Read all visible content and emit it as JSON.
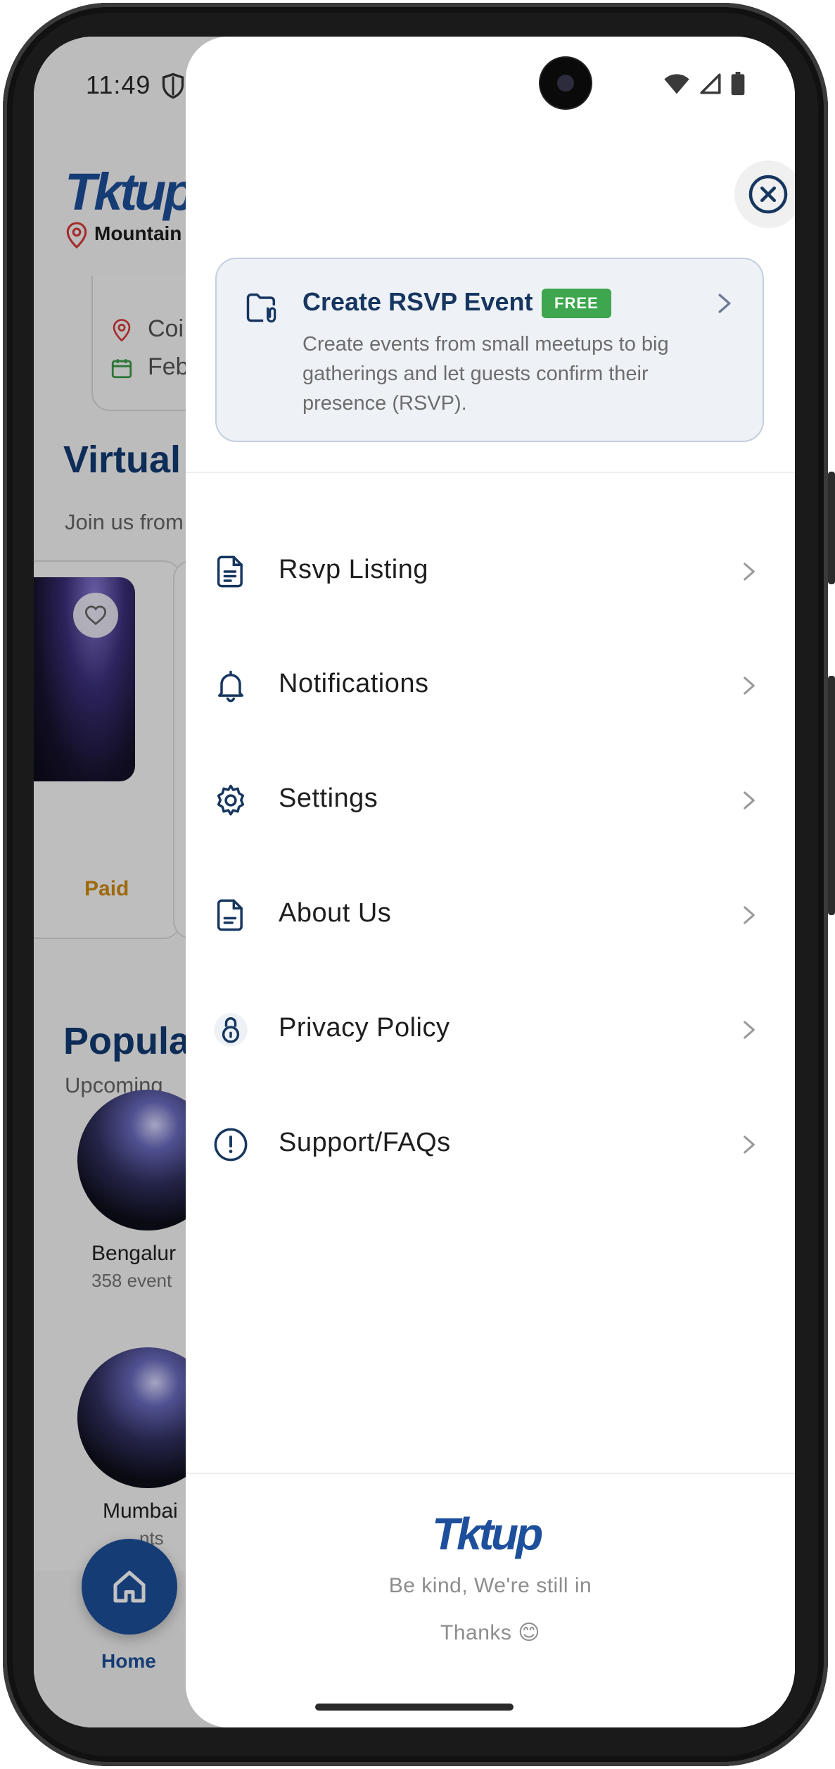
{
  "status_bar": {
    "time": "11:49"
  },
  "background_app": {
    "logo": "Tktup",
    "location": "Mountain V",
    "card_rows": [
      {
        "text": "Coi"
      },
      {
        "text": "Feb"
      }
    ],
    "virtual_heading": "Virtual",
    "virtual_sub": "Join us from",
    "event_price": "Paid",
    "popular_heading": "Popula",
    "popular_sub": "Upcoming",
    "cities": [
      {
        "name": "Bengalur",
        "count": "358 event"
      },
      {
        "name": "Mumbai",
        "count": "nts"
      }
    ],
    "nav_home": "Home"
  },
  "drawer": {
    "rsvp": {
      "title": "Create RSVP Event",
      "badge": "FREE",
      "description": "Create events from small meetups to big gatherings and let guests confirm their presence (RSVP)."
    },
    "menu": [
      {
        "label": "Rsvp Listing",
        "icon": "document-list-icon"
      },
      {
        "label": "Notifications",
        "icon": "bell-icon"
      },
      {
        "label": "Settings",
        "icon": "gear-icon"
      },
      {
        "label": "About Us",
        "icon": "document-icon"
      },
      {
        "label": "Privacy Policy",
        "icon": "lock-icon"
      },
      {
        "label": "Support/FAQs",
        "icon": "alert-circle-icon"
      }
    ],
    "footer": {
      "logo": "Tktup",
      "line1": "Be kind, We're still in",
      "line2": "Thanks 😊"
    }
  },
  "colors": {
    "brand": "#1d4f9c",
    "free_badge": "#3ea64e",
    "paid": "#d18a12"
  }
}
